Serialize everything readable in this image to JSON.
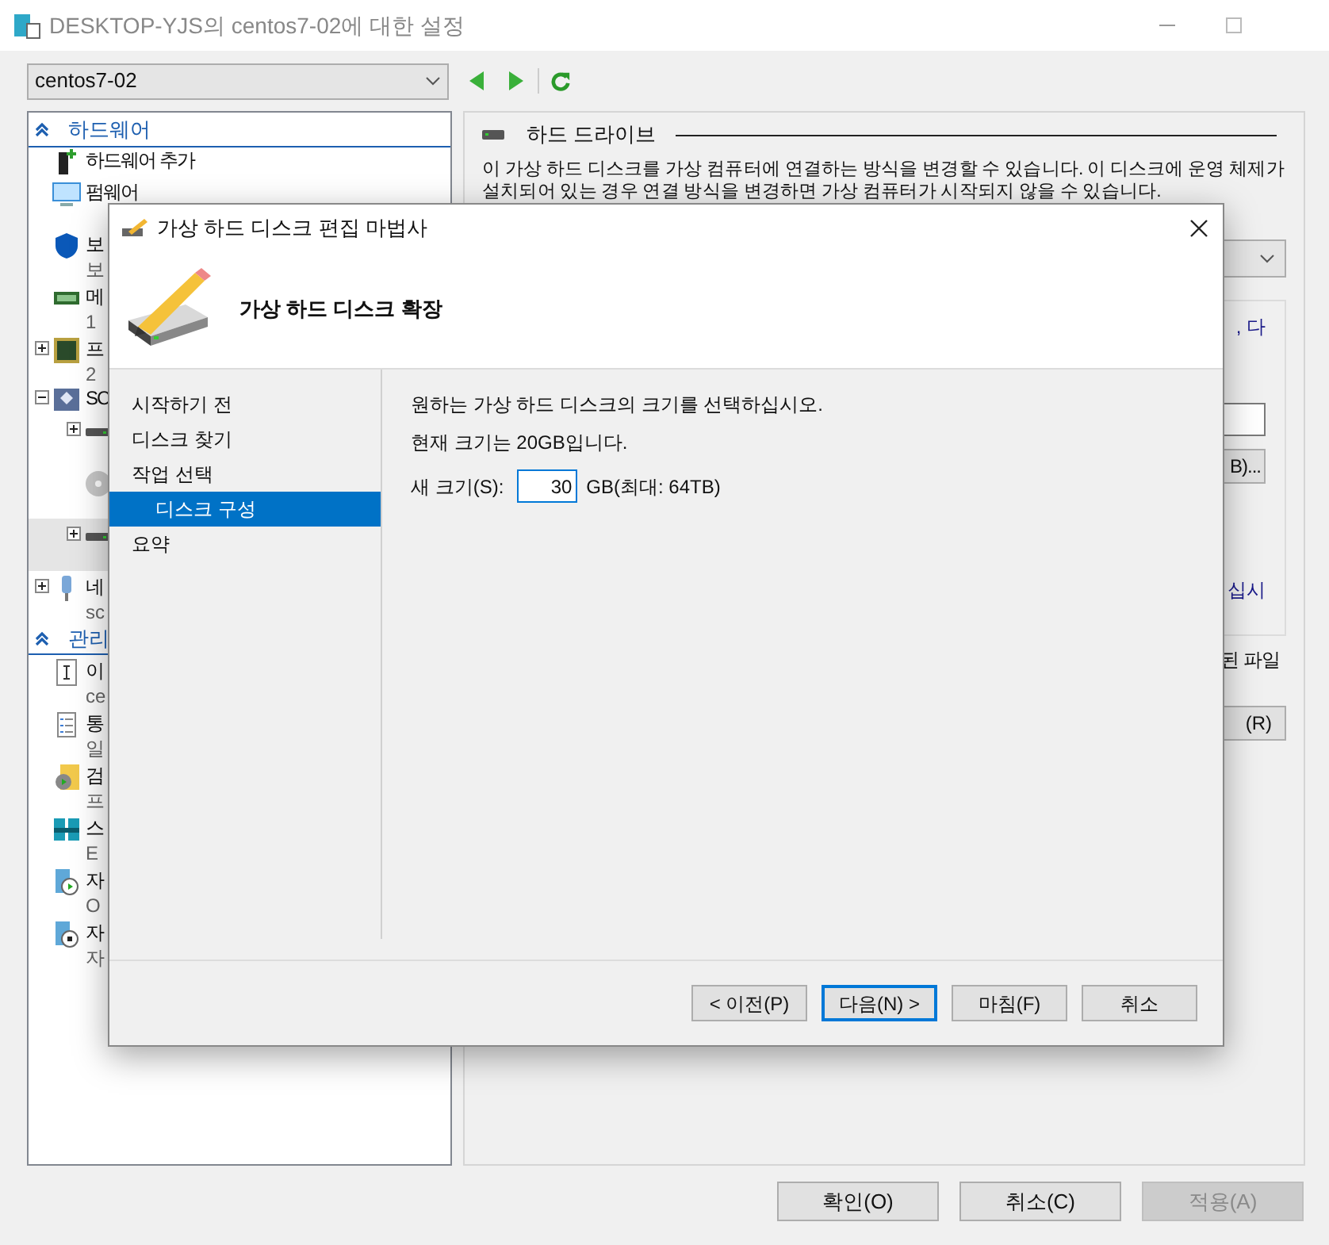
{
  "window": {
    "title": "DESKTOP-YJS의 centos7-02에 대한 설정",
    "vm_select": {
      "value": "centos7-02"
    }
  },
  "tree": {
    "sections": [
      {
        "title": "하드웨어",
        "items": [
          {
            "kind": "add-hardware",
            "label": "하드웨어 추가",
            "selected": false
          },
          {
            "kind": "firmware",
            "label": "펌웨어",
            "selected": false
          },
          {
            "kind": "security",
            "label": "보",
            "sub": "보",
            "selected": false
          },
          {
            "kind": "memory",
            "label": "메",
            "sub": "1",
            "selected": false
          },
          {
            "kind": "processor",
            "label": "프",
            "sub": "2",
            "expanded": false,
            "selected": false
          },
          {
            "kind": "scsi",
            "label": "SC",
            "expanded": true,
            "selected": false,
            "children": [
              {
                "kind": "drive",
                "expanded": false,
                "selected": false
              },
              {
                "kind": "dvd",
                "selected": false
              },
              {
                "kind": "drive",
                "expanded": false,
                "selected": true
              }
            ]
          },
          {
            "kind": "network",
            "label": "네",
            "sub": "sc",
            "expanded": false,
            "selected": false
          }
        ]
      },
      {
        "title": "관리",
        "items": [
          {
            "kind": "name",
            "label": "이",
            "sub": "ce",
            "selected": false
          },
          {
            "kind": "integration",
            "label": "통",
            "sub": "일",
            "selected": false
          },
          {
            "kind": "checkpoint",
            "label": "검",
            "sub": "프",
            "selected": false
          },
          {
            "kind": "paging",
            "label": "스",
            "sub": "E",
            "selected": false
          },
          {
            "kind": "start",
            "label": "자",
            "sub": "O",
            "selected": false
          },
          {
            "kind": "stop",
            "label": "자",
            "sub": "자",
            "selected": false
          }
        ]
      }
    ]
  },
  "panel": {
    "title": "하드 드라이브",
    "description": "이 가상 하드 디스크를 가상 컴퓨터에 연결하는 방식을 변경할 수 있습니다. 이 디스크에 운영 체제가 설치되어 있는 경우 연결 방식을 변경하면 가상 컴퓨터가 시작되지 않을 수 있습니다.",
    "note_fragment": ", 다",
    "browse_button": "B)...",
    "note_fragment_2": "십시",
    "note_fragment_3": "된 파일",
    "remove_button": "(R)"
  },
  "dialog": {
    "title": "가상 하드 디스크 편집 마법사",
    "heading": "가상 하드 디스크 확장",
    "steps": [
      {
        "label": "시작하기 전",
        "selected": false
      },
      {
        "label": "디스크 찾기",
        "selected": false
      },
      {
        "label": "작업 선택",
        "selected": false,
        "children": [
          {
            "label": "디스크 구성",
            "selected": true
          }
        ]
      },
      {
        "label": "요약",
        "selected": false
      }
    ],
    "lines": [
      "원하는 가상 하드 디스크의 크기를 선택하십시오.",
      "현재 크기는 20GB입니다."
    ],
    "size_label": "새 크기(S):",
    "size_value": "30",
    "size_unit": "GB(최대: 64TB)",
    "buttons": [
      {
        "label": "< 이전(P)",
        "focused": false
      },
      {
        "label": "다음(N) >",
        "focused": true
      },
      {
        "label": "마침(F)",
        "focused": false
      },
      {
        "label": "취소",
        "focused": false
      }
    ]
  },
  "buttons": [
    {
      "label": "확인(O)",
      "disabled": false
    },
    {
      "label": "취소(C)",
      "disabled": false
    },
    {
      "label": "적용(A)",
      "disabled": true
    }
  ]
}
